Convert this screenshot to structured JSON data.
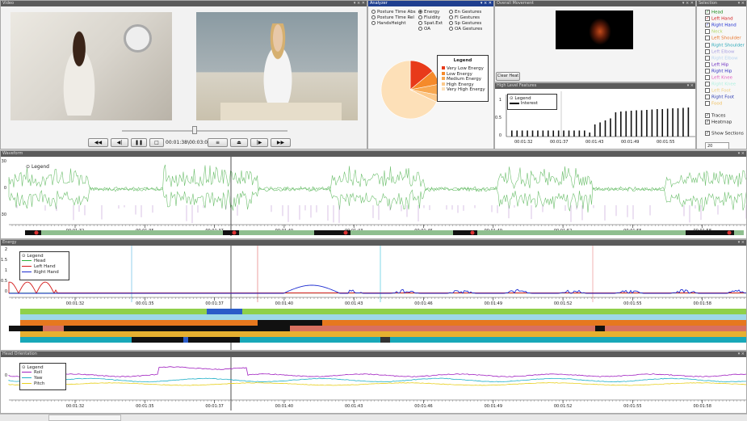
{
  "video": {
    "title": "Video",
    "time": "00:01:38\\00:03:02"
  },
  "analyzer": {
    "title": "Analyzer",
    "options": [
      "Posture Time Abs",
      "Posture Time Rel",
      "HandsHeight",
      "Energy",
      "Fluidity",
      "Spat.Ext",
      "OA",
      "En Gestures",
      "Fl Gestures",
      "Sp Gestures",
      "OA Gestures"
    ],
    "legend_title": "Legend",
    "legend_items": [
      "Very Low Energy",
      "Low Energy",
      "Medium Energy",
      "High Energy",
      "Very High Energy"
    ],
    "legend_colors": [
      "#e83a1a",
      "#f58a2a",
      "#f7a851",
      "#fcc98a",
      "#fde0b8"
    ],
    "pie": [
      0.14,
      0.08,
      0.06,
      0.04,
      0.68
    ]
  },
  "overall": {
    "title": "Overall Movement",
    "clear_label": "Clear Heat"
  },
  "hlf": {
    "title": "High Level Features",
    "legend_title": "Legend",
    "legend_item": "Interest",
    "yticks": [
      "1",
      "0.5",
      "0"
    ],
    "xticks": [
      "00:01:32",
      "00:01:37",
      "00:01:43",
      "00:01:49",
      "00:01:55"
    ],
    "bars": [
      0.15,
      0.15,
      0.15,
      0.15,
      0.15,
      0.15,
      0.15,
      0.15,
      0.15,
      0.15,
      0.15,
      0.15,
      0.15,
      0.15,
      0.15,
      0.1,
      0.3,
      0.35,
      0.4,
      0.45,
      0.6,
      0.62,
      0.63,
      0.64,
      0.65,
      0.65,
      0.66,
      0.67,
      0.68,
      0.68,
      0.69,
      0.7,
      0.7,
      0.71,
      0.72
    ]
  },
  "selection": {
    "title": "Selection",
    "items": [
      {
        "label": "Head",
        "color": "#1a8a1a",
        "checked": true
      },
      {
        "label": "Left Hand",
        "color": "#d31919",
        "checked": true
      },
      {
        "label": "Right Hand",
        "color": "#1b2bd0",
        "checked": true
      },
      {
        "label": "Neck",
        "color": "#b5d86a",
        "checked": false
      },
      {
        "label": "Left Shoulder",
        "color": "#e8742a",
        "checked": false
      },
      {
        "label": "Right Shoulder",
        "color": "#29a8b8",
        "checked": false
      },
      {
        "label": "Left Elbow",
        "color": "#a8a0e0",
        "checked": false
      },
      {
        "label": "Right Elbow",
        "color": "#b8d4f0",
        "checked": false
      },
      {
        "label": "Left Hip",
        "color": "#6a2ac0",
        "checked": false
      },
      {
        "label": "Right Hip",
        "color": "#2a2ac0",
        "checked": false
      },
      {
        "label": "Left Knee",
        "color": "#e060c0",
        "checked": false
      },
      {
        "label": "Right Knee",
        "color": "#b0f0e0",
        "checked": false
      },
      {
        "label": "Left Foot",
        "color": "#f0d080",
        "checked": false
      },
      {
        "label": "Right Foot",
        "color": "#2a3ab0",
        "checked": false
      },
      {
        "label": "Food",
        "color": "#f0c060",
        "checked": false
      }
    ],
    "traces": "Traces",
    "heatmap": "Heatmap",
    "show_sections": "Show Sections",
    "sections_value": "20"
  },
  "waveform": {
    "title": "Waveform",
    "legend": "Legend",
    "yticks": [
      "30",
      "0",
      "-30"
    ],
    "xticks": [
      "00:01:32",
      "00:01:35",
      "00:01:37",
      "00:01:40",
      "00:01:43",
      "00:01:46",
      "00:01:49",
      "00:01:52",
      "00:01:55",
      "00:01:58"
    ]
  },
  "energy": {
    "title": "Energy",
    "legend": "Legend",
    "series": [
      "Head",
      "Left Hand",
      "Right Hand"
    ],
    "series_colors": [
      "#2ab03a",
      "#d31919",
      "#1b2bd0"
    ],
    "yticks": [
      "2",
      "1.5",
      "1",
      "0.5",
      "0"
    ],
    "xticks": [
      "00:01:32",
      "00:01:35",
      "00:01:37",
      "00:01:40",
      "00:01:43",
      "00:01:46",
      "00:01:49",
      "00:01:52",
      "00:01:55",
      "00:01:58"
    ]
  },
  "head": {
    "title": "Head Orientation",
    "legend": "Legend",
    "series": [
      "Roll",
      "Yaw",
      "Pitch"
    ],
    "series_colors": [
      "#a020c0",
      "#20b0c8",
      "#e8d020"
    ],
    "yticks": [
      "0"
    ],
    "xticks": [
      "00:01:32",
      "00:01:35",
      "00:01:37",
      "00:01:40",
      "00:01:43",
      "00:01:46",
      "00:01:49",
      "00:01:52",
      "00:01:55",
      "00:01:58"
    ]
  }
}
